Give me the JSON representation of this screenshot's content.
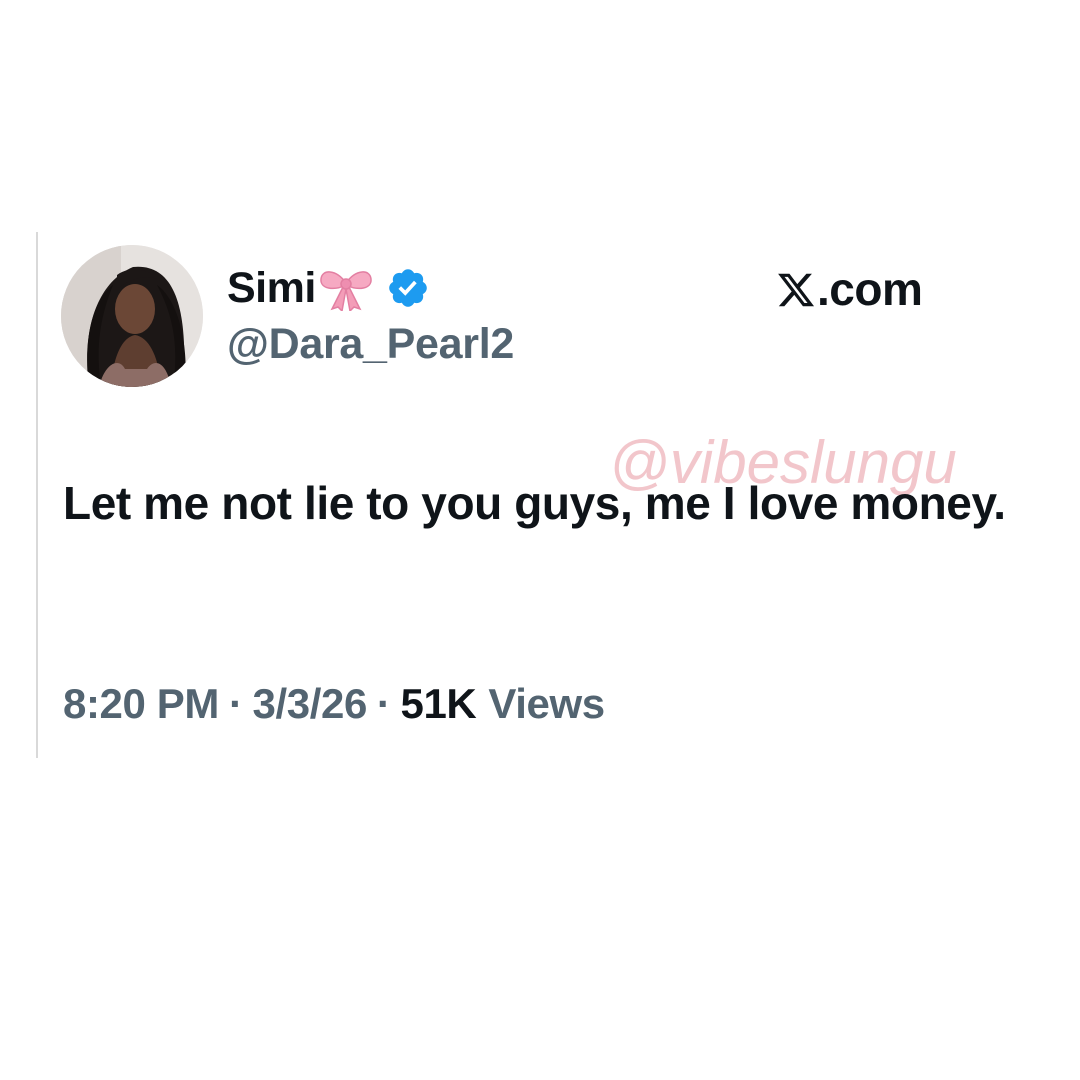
{
  "post": {
    "display_name": "Simi",
    "handle": "@Dara_Pearl2",
    "site": ".com",
    "text": "Let me not lie to you guys, me I love money.",
    "time": "8:20 PM",
    "separator": "·",
    "date": "3/3/26",
    "views_count": "51K",
    "views_label": "Views"
  },
  "watermark": "@vibeslungu",
  "icons": {
    "name_emoji": "ribbon-bow-icon",
    "badge": "verified-badge-icon",
    "brand": "x-logo-icon"
  },
  "colors": {
    "text_primary": "#0f1419",
    "text_secondary": "#536471",
    "verified_blue": "#1d9bf0",
    "bow_pink": "#f39db8",
    "watermark_pink": "#f2c6cb"
  }
}
